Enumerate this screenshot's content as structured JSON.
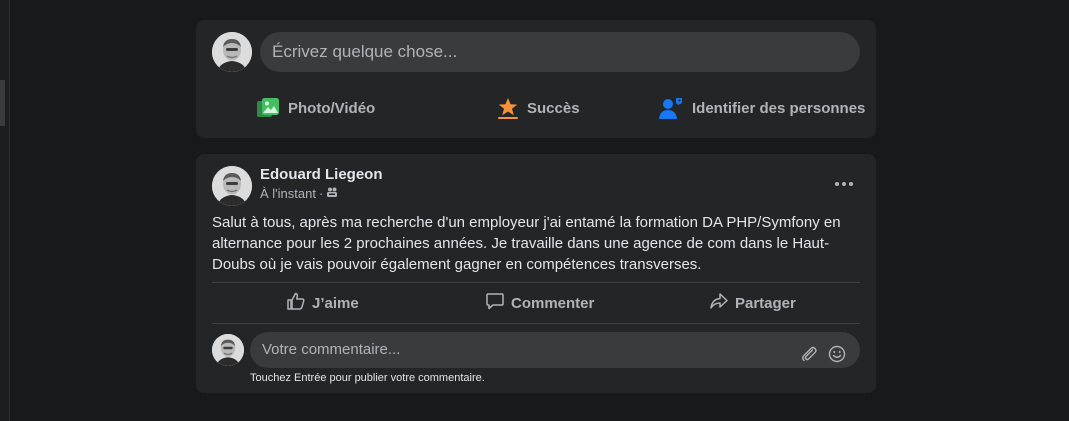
{
  "composer": {
    "placeholder": "Écrivez quelque chose...",
    "actions": [
      {
        "label": "Photo/Vidéo",
        "icon": "photo-video-icon",
        "color": "#45bd62"
      },
      {
        "label": "Succès",
        "icon": "star-flag-icon",
        "color": "#f7923b"
      },
      {
        "label": "Identifier des personnes",
        "icon": "tag-people-icon",
        "color": "#1877f2"
      }
    ]
  },
  "post": {
    "author": "Edouard Liegeon",
    "timestamp": "À l'instant",
    "separator": "·",
    "audience_icon": "friends-audience-icon",
    "more_icon": "more-options-icon",
    "text": "Salut à tous, après ma recherche d'un employeur j'ai entamé la formation DA PHP/Symfony en alternance pour les 2 prochaines années. Je travaille dans une agence de com dans le Haut-Doubs où je vais pouvoir également gagner en compétences transverses.",
    "actions": [
      {
        "label": "J’aime",
        "icon": "like-thumb-icon"
      },
      {
        "label": "Commenter",
        "icon": "comment-bubble-icon"
      },
      {
        "label": "Partager",
        "icon": "share-arrow-icon"
      }
    ]
  },
  "comment": {
    "placeholder": "Votre commentaire...",
    "hint": "Touchez Entrée pour publier votre commentaire.",
    "icons": [
      "attachment-icon",
      "emoji-icon"
    ]
  },
  "colors": {
    "background": "#18191a",
    "card": "#242526",
    "input": "#3a3b3c",
    "text_primary": "#e4e6eb",
    "text_secondary": "#b0b3b8"
  }
}
